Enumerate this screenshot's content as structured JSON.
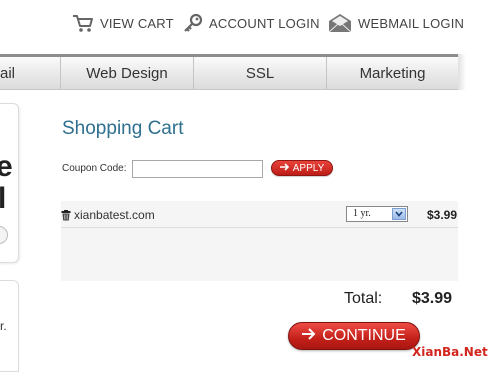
{
  "toplinks": {
    "view_cart": "VIEW CART",
    "account_login": "ACCOUNT LOGIN",
    "webmail_login": "WEBMAIL LOGIN"
  },
  "nav": {
    "items": [
      "ail",
      "Web Design",
      "SSL",
      "Marketing"
    ]
  },
  "left_promo": {
    "letter_e": "e",
    "letter_l": "l",
    "letter_r": "r."
  },
  "cart": {
    "title": "Shopping Cart",
    "coupon_label": "Coupon Code:",
    "coupon_value": "",
    "apply_label": "APPLY",
    "items": [
      {
        "domain": "xianbatest.com",
        "term": "1 yr.",
        "price": "$3.99"
      }
    ],
    "total_label": "Total:",
    "total_value": "$3.99",
    "continue_label": "CONTINUE"
  },
  "watermark": "XianBa.Net",
  "colors": {
    "title": "#2f6f8f",
    "button_red": "#c4201a",
    "watermark": "#d2261f"
  },
  "icons": [
    "cart-icon",
    "key-icon",
    "envelope-icon",
    "arrow-right-icon",
    "trash-icon",
    "chevron-down-icon"
  ]
}
